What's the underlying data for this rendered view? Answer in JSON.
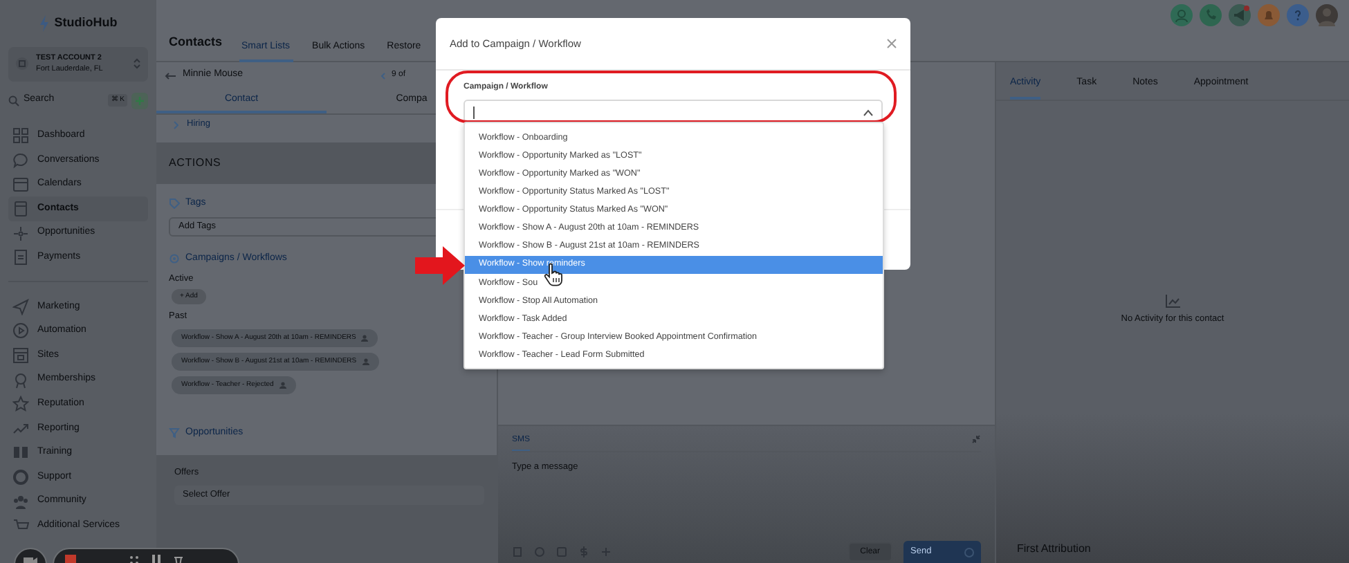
{
  "sidebar": {
    "logo": "StudioHub",
    "account": {
      "name": "TEST ACCOUNT 2",
      "location": "Fort Lauderdale, FL"
    },
    "search": {
      "placeholder": "Search",
      "shortcut": "⌘ K"
    },
    "nav_groups": [
      [
        {
          "label": "Dashboard",
          "selected": false
        },
        {
          "label": "Conversations",
          "selected": false
        },
        {
          "label": "Calendars",
          "selected": false
        },
        {
          "label": "Contacts",
          "selected": true
        },
        {
          "label": "Opportunities",
          "selected": false
        },
        {
          "label": "Payments",
          "selected": false
        }
      ],
      [
        {
          "label": "Marketing",
          "selected": false
        },
        {
          "label": "Automation",
          "selected": false
        },
        {
          "label": "Sites",
          "selected": false
        },
        {
          "label": "Memberships",
          "selected": false
        },
        {
          "label": "Reputation",
          "selected": false
        },
        {
          "label": "Reporting",
          "selected": false
        },
        {
          "label": "Training",
          "selected": false
        },
        {
          "label": "Support",
          "selected": false
        },
        {
          "label": "Community",
          "selected": false
        },
        {
          "label": "Additional Services",
          "selected": false
        }
      ]
    ]
  },
  "header": {
    "title": "Contacts",
    "tabs": [
      {
        "label": "Smart Lists",
        "selected": true
      },
      {
        "label": "Bulk Actions",
        "selected": false
      },
      {
        "label": "Restore",
        "selected": false
      }
    ]
  },
  "contact": {
    "name": "Minnie Mouse",
    "pager": "9 of",
    "tabs": [
      {
        "label": "Contact",
        "selected": true
      },
      {
        "label": "Compa",
        "selected": false
      }
    ],
    "section": "Hiring",
    "actions_title": "ACTIONS",
    "tags": {
      "title": "Tags",
      "placeholder": "Add Tags"
    },
    "campaigns": {
      "title": "Campaigns / Workflows",
      "active_label": "Active",
      "add_button": "+ Add",
      "past_label": "Past",
      "past": [
        "Workflow - Show A - August 20th at 10am - REMINDERS",
        "Workflow - Show B - August 21st at 10am - REMINDERS",
        "Workflow - Teacher - Rejected"
      ]
    },
    "opportunities": {
      "title": "Opportunities",
      "offers_label": "Offers",
      "offer_placeholder": "Select Offer"
    }
  },
  "composer": {
    "tabs": [
      {
        "label": "SMS",
        "selected": true
      }
    ],
    "placeholder": "Type a message",
    "clear_button": "Clear",
    "send_button": "Send"
  },
  "activity": {
    "tabs": [
      {
        "label": "Activity",
        "selected": true
      },
      {
        "label": "Task",
        "selected": false
      },
      {
        "label": "Notes",
        "selected": false
      },
      {
        "label": "Appointment",
        "selected": false
      }
    ],
    "empty_text": "No Activity for this contact",
    "first_attribution": "First Attribution"
  },
  "modal": {
    "title": "Add to Campaign / Workflow",
    "field_label": "Campaign / Workflow",
    "options": [
      {
        "label": "Workflow - Onboarding",
        "selected": false
      },
      {
        "label": "Workflow - Opportunity Marked as \"LOST\"",
        "selected": false
      },
      {
        "label": "Workflow - Opportunity Marked as \"WON\"",
        "selected": false
      },
      {
        "label": "Workflow - Opportunity Status Marked As \"LOST\"",
        "selected": false
      },
      {
        "label": "Workflow - Opportunity Status Marked As \"WON\"",
        "selected": false
      },
      {
        "label": "Workflow - Show A - August 20th at 10am - REMINDERS",
        "selected": false
      },
      {
        "label": "Workflow - Show B - August 21st at 10am - REMINDERS",
        "selected": false
      },
      {
        "label": "Workflow - Show reminders",
        "selected": true
      },
      {
        "label": "Workflow - Sou",
        "selected": false
      },
      {
        "label": "Workflow - Stop All Automation",
        "selected": false
      },
      {
        "label": "Workflow - Task Added",
        "selected": false
      },
      {
        "label": "Workflow - Teacher - Group Interview Booked Appointment Confirmation",
        "selected": false
      },
      {
        "label": "Workflow - Teacher - Lead Form Submitted",
        "selected": false
      }
    ]
  }
}
